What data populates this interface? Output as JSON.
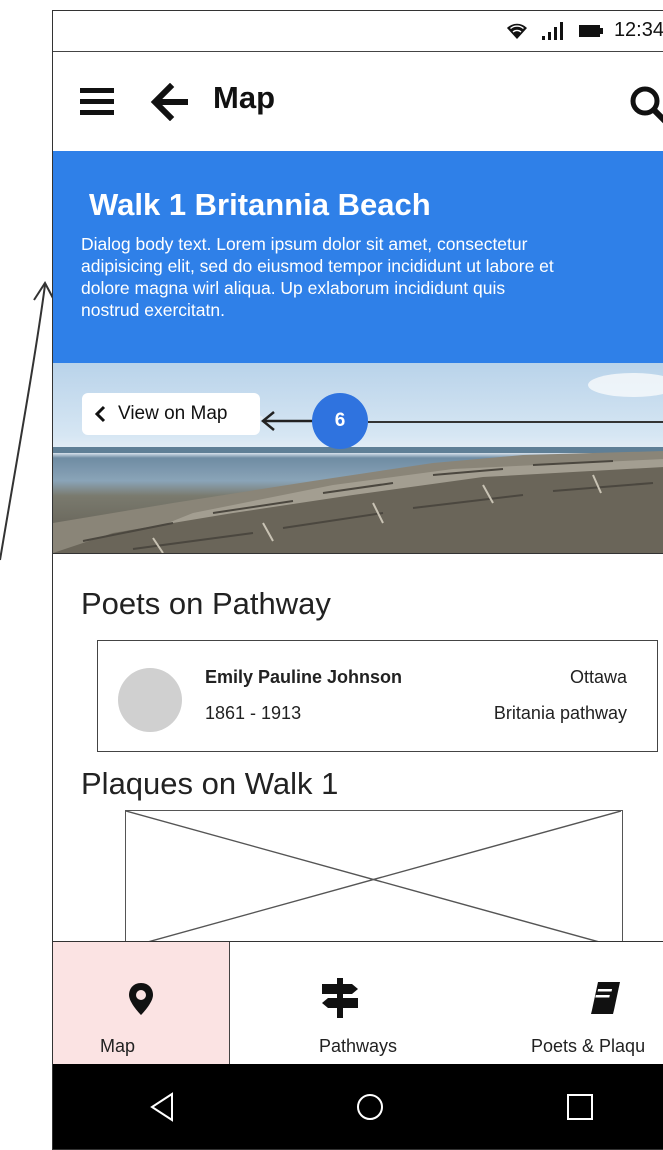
{
  "status_bar": {
    "time": "12:34",
    "icons": [
      "wifi-icon",
      "signal-icon",
      "battery-icon"
    ]
  },
  "app_bar": {
    "title": "Map",
    "icons": [
      "menu-icon",
      "back-arrow-icon",
      "search-icon"
    ]
  },
  "hero": {
    "title": "Walk 1 Britannia Beach",
    "body_lines": [
      "Dialog body text.  Lorem ipsum dolor sit amet, consectetur",
      "adipisicing elit, sed do eiusmod tempor incididunt ut labore et",
      "dolore magna wirl aliqua. Up exlaborum incididunt quis",
      "nostrud exercitatn."
    ],
    "background_color": "#2f80e8"
  },
  "photo": {
    "view_on_map_label": "View on Map",
    "badge_number": "6",
    "badge_color": "#2f73df"
  },
  "poets_section": {
    "title": "Poets on Pathway",
    "poets": [
      {
        "name": "Emily Pauline Johnson",
        "years": "1861 - 1913",
        "city": "Ottawa",
        "pathway": "Britania pathway"
      }
    ]
  },
  "plaques_section": {
    "title": "Plaques on Walk 1"
  },
  "bottom_nav": {
    "items": [
      {
        "label": "Map",
        "icon": "map-pin-icon",
        "active": true
      },
      {
        "label": "Pathways",
        "icon": "signpost-icon",
        "active": false
      },
      {
        "label": "Poets & Plaqu",
        "icon": "book-icon",
        "active": false
      }
    ],
    "active_background": "#fbe3e3"
  },
  "system_bar": {
    "buttons": [
      "back-triangle-icon",
      "home-circle-icon",
      "recents-square-icon"
    ]
  }
}
